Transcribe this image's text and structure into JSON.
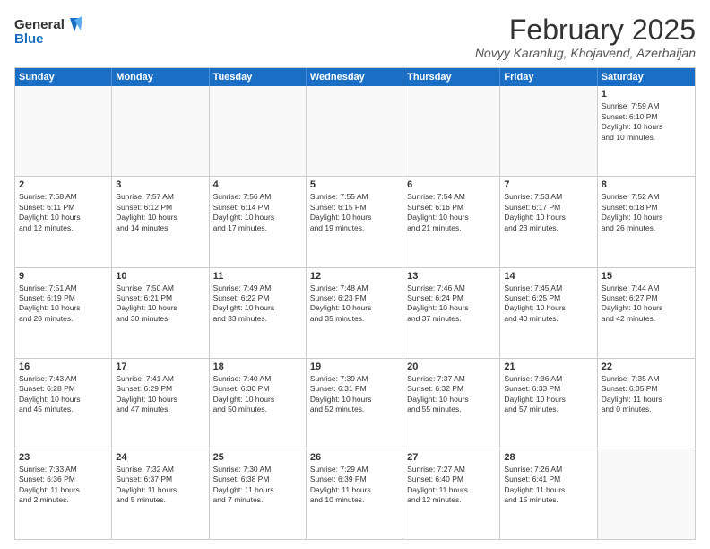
{
  "logo": {
    "line1": "General",
    "line2": "Blue"
  },
  "title": "February 2025",
  "subtitle": "Novyy Karanlug, Khojavend, Azerbaijan",
  "days_of_week": [
    "Sunday",
    "Monday",
    "Tuesday",
    "Wednesday",
    "Thursday",
    "Friday",
    "Saturday"
  ],
  "weeks": [
    [
      {
        "day": "",
        "info": ""
      },
      {
        "day": "",
        "info": ""
      },
      {
        "day": "",
        "info": ""
      },
      {
        "day": "",
        "info": ""
      },
      {
        "day": "",
        "info": ""
      },
      {
        "day": "",
        "info": ""
      },
      {
        "day": "1",
        "info": "Sunrise: 7:59 AM\nSunset: 6:10 PM\nDaylight: 10 hours\nand 10 minutes."
      }
    ],
    [
      {
        "day": "2",
        "info": "Sunrise: 7:58 AM\nSunset: 6:11 PM\nDaylight: 10 hours\nand 12 minutes."
      },
      {
        "day": "3",
        "info": "Sunrise: 7:57 AM\nSunset: 6:12 PM\nDaylight: 10 hours\nand 14 minutes."
      },
      {
        "day": "4",
        "info": "Sunrise: 7:56 AM\nSunset: 6:14 PM\nDaylight: 10 hours\nand 17 minutes."
      },
      {
        "day": "5",
        "info": "Sunrise: 7:55 AM\nSunset: 6:15 PM\nDaylight: 10 hours\nand 19 minutes."
      },
      {
        "day": "6",
        "info": "Sunrise: 7:54 AM\nSunset: 6:16 PM\nDaylight: 10 hours\nand 21 minutes."
      },
      {
        "day": "7",
        "info": "Sunrise: 7:53 AM\nSunset: 6:17 PM\nDaylight: 10 hours\nand 23 minutes."
      },
      {
        "day": "8",
        "info": "Sunrise: 7:52 AM\nSunset: 6:18 PM\nDaylight: 10 hours\nand 26 minutes."
      }
    ],
    [
      {
        "day": "9",
        "info": "Sunrise: 7:51 AM\nSunset: 6:19 PM\nDaylight: 10 hours\nand 28 minutes."
      },
      {
        "day": "10",
        "info": "Sunrise: 7:50 AM\nSunset: 6:21 PM\nDaylight: 10 hours\nand 30 minutes."
      },
      {
        "day": "11",
        "info": "Sunrise: 7:49 AM\nSunset: 6:22 PM\nDaylight: 10 hours\nand 33 minutes."
      },
      {
        "day": "12",
        "info": "Sunrise: 7:48 AM\nSunset: 6:23 PM\nDaylight: 10 hours\nand 35 minutes."
      },
      {
        "day": "13",
        "info": "Sunrise: 7:46 AM\nSunset: 6:24 PM\nDaylight: 10 hours\nand 37 minutes."
      },
      {
        "day": "14",
        "info": "Sunrise: 7:45 AM\nSunset: 6:25 PM\nDaylight: 10 hours\nand 40 minutes."
      },
      {
        "day": "15",
        "info": "Sunrise: 7:44 AM\nSunset: 6:27 PM\nDaylight: 10 hours\nand 42 minutes."
      }
    ],
    [
      {
        "day": "16",
        "info": "Sunrise: 7:43 AM\nSunset: 6:28 PM\nDaylight: 10 hours\nand 45 minutes."
      },
      {
        "day": "17",
        "info": "Sunrise: 7:41 AM\nSunset: 6:29 PM\nDaylight: 10 hours\nand 47 minutes."
      },
      {
        "day": "18",
        "info": "Sunrise: 7:40 AM\nSunset: 6:30 PM\nDaylight: 10 hours\nand 50 minutes."
      },
      {
        "day": "19",
        "info": "Sunrise: 7:39 AM\nSunset: 6:31 PM\nDaylight: 10 hours\nand 52 minutes."
      },
      {
        "day": "20",
        "info": "Sunrise: 7:37 AM\nSunset: 6:32 PM\nDaylight: 10 hours\nand 55 minutes."
      },
      {
        "day": "21",
        "info": "Sunrise: 7:36 AM\nSunset: 6:33 PM\nDaylight: 10 hours\nand 57 minutes."
      },
      {
        "day": "22",
        "info": "Sunrise: 7:35 AM\nSunset: 6:35 PM\nDaylight: 11 hours\nand 0 minutes."
      }
    ],
    [
      {
        "day": "23",
        "info": "Sunrise: 7:33 AM\nSunset: 6:36 PM\nDaylight: 11 hours\nand 2 minutes."
      },
      {
        "day": "24",
        "info": "Sunrise: 7:32 AM\nSunset: 6:37 PM\nDaylight: 11 hours\nand 5 minutes."
      },
      {
        "day": "25",
        "info": "Sunrise: 7:30 AM\nSunset: 6:38 PM\nDaylight: 11 hours\nand 7 minutes."
      },
      {
        "day": "26",
        "info": "Sunrise: 7:29 AM\nSunset: 6:39 PM\nDaylight: 11 hours\nand 10 minutes."
      },
      {
        "day": "27",
        "info": "Sunrise: 7:27 AM\nSunset: 6:40 PM\nDaylight: 11 hours\nand 12 minutes."
      },
      {
        "day": "28",
        "info": "Sunrise: 7:26 AM\nSunset: 6:41 PM\nDaylight: 11 hours\nand 15 minutes."
      },
      {
        "day": "",
        "info": ""
      }
    ]
  ]
}
